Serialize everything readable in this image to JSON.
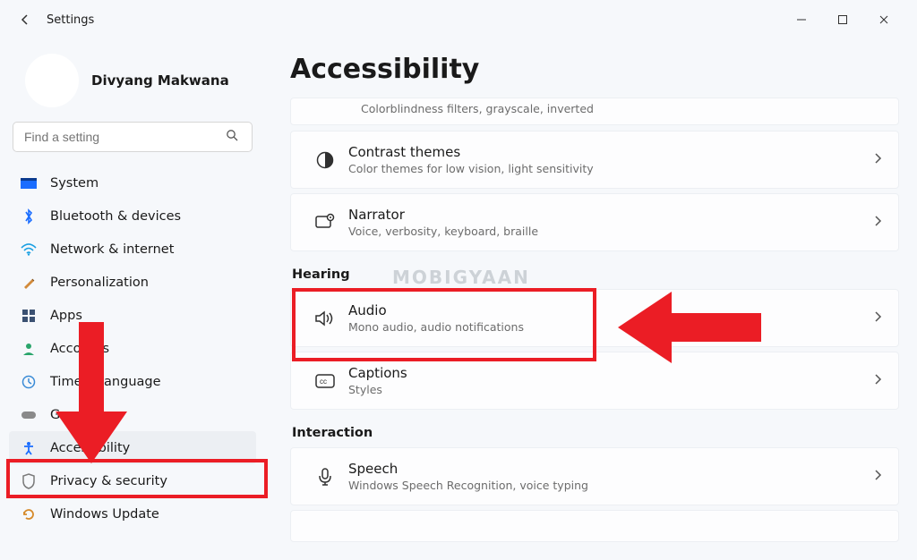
{
  "window": {
    "back_tooltip": "Back",
    "title": "Settings",
    "min": "—",
    "max": "▢",
    "close": "✕"
  },
  "profile": {
    "name": "Divyang Makwana"
  },
  "search": {
    "placeholder": "Find a setting"
  },
  "nav": [
    {
      "key": "system",
      "label": "System",
      "active": false
    },
    {
      "key": "bluetooth",
      "label": "Bluetooth & devices",
      "active": false
    },
    {
      "key": "network",
      "label": "Network & internet",
      "active": false
    },
    {
      "key": "personalization",
      "label": "Personalization",
      "active": false
    },
    {
      "key": "apps",
      "label": "Apps",
      "active": false
    },
    {
      "key": "accounts",
      "label": "Accounts",
      "active": false
    },
    {
      "key": "time",
      "label": "Time & language",
      "active": false
    },
    {
      "key": "gaming",
      "label": "Gaming",
      "active": false
    },
    {
      "key": "accessibility",
      "label": "Accessibility",
      "active": true
    },
    {
      "key": "privacy",
      "label": "Privacy & security",
      "active": false
    },
    {
      "key": "update",
      "label": "Windows Update",
      "active": false
    }
  ],
  "page": {
    "title": "Accessibility",
    "partial_top_sub": "Colorblindness filters, grayscale, inverted",
    "sections": {
      "vision_rows": [
        {
          "key": "contrast",
          "title": "Contrast themes",
          "sub": "Color themes for low vision, light sensitivity"
        },
        {
          "key": "narrator",
          "title": "Narrator",
          "sub": "Voice, verbosity, keyboard, braille"
        }
      ],
      "hearing_heading": "Hearing",
      "hearing_rows": [
        {
          "key": "audio",
          "title": "Audio",
          "sub": "Mono audio, audio notifications"
        },
        {
          "key": "captions",
          "title": "Captions",
          "sub": "Styles"
        }
      ],
      "interaction_heading": "Interaction",
      "interaction_rows": [
        {
          "key": "speech",
          "title": "Speech",
          "sub": "Windows Speech Recognition, voice typing"
        }
      ]
    }
  },
  "annotations": {
    "watermark": "MOBIGYAAN"
  }
}
